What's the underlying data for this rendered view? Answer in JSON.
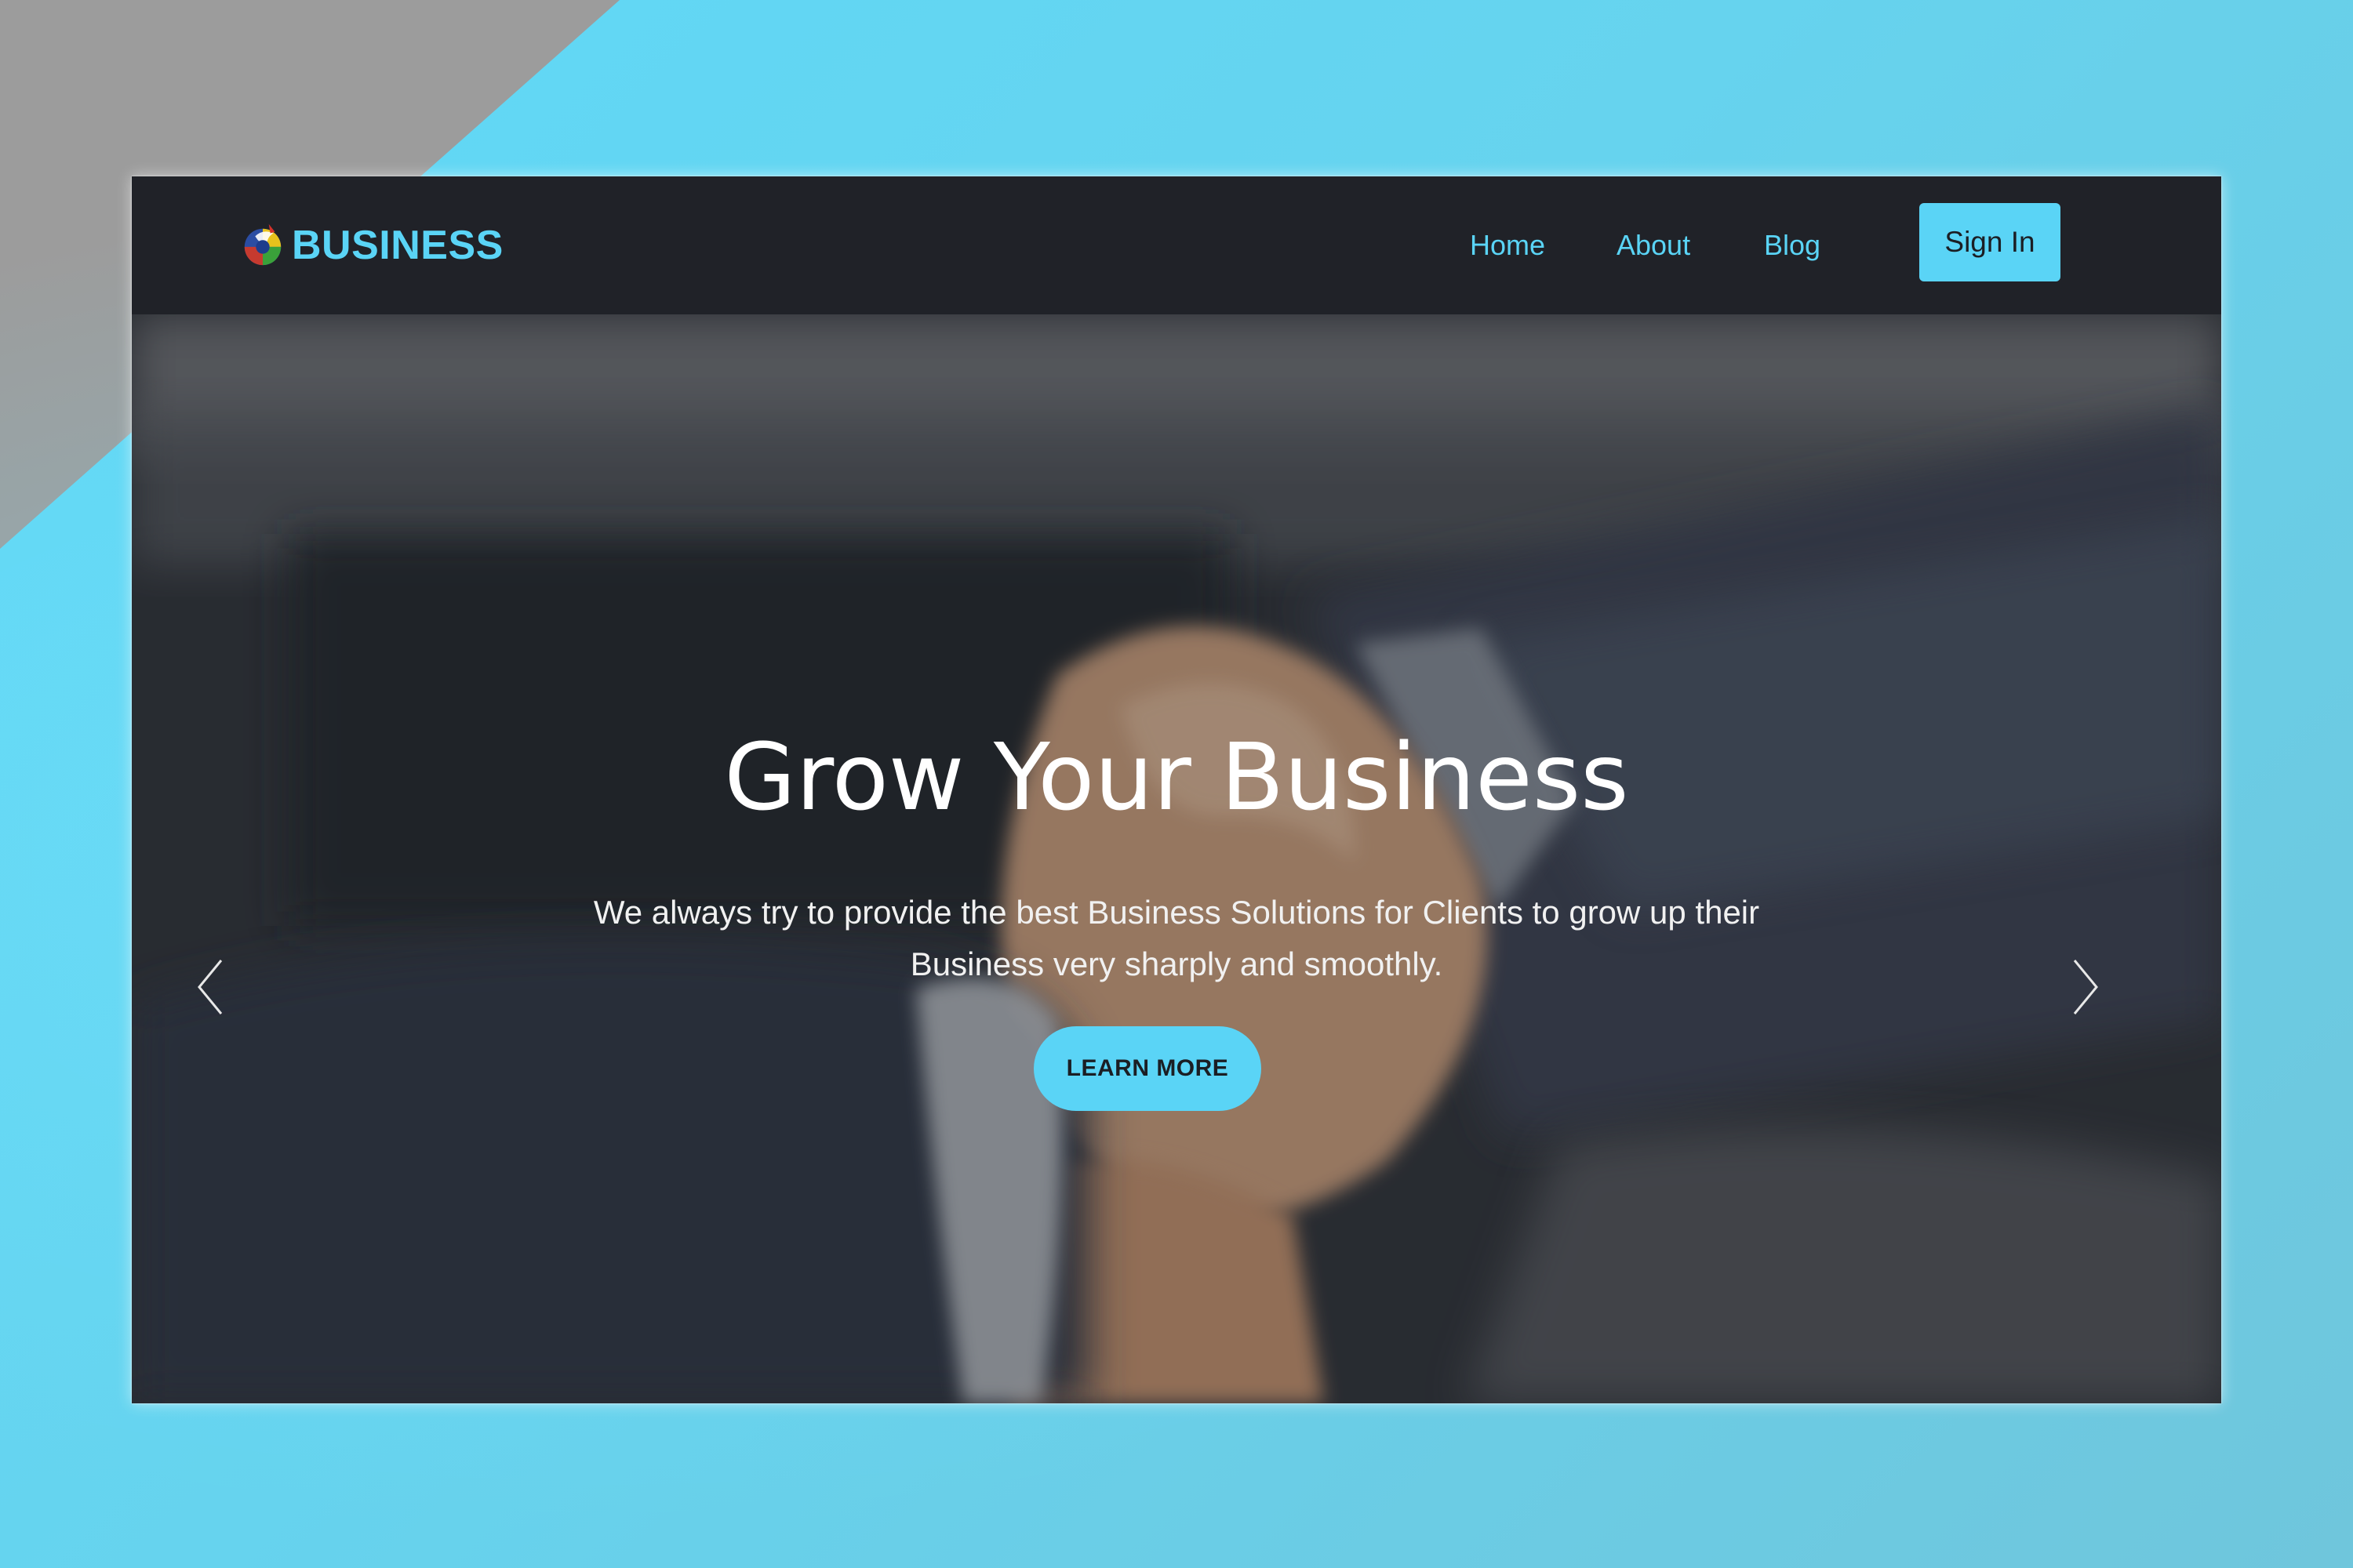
{
  "navbar": {
    "brand": {
      "name": "BUSINESS",
      "logo_icon": "globe-logo-icon"
    },
    "links": [
      {
        "label": "Home"
      },
      {
        "label": "About"
      },
      {
        "label": "Blog"
      }
    ],
    "signin_label": "Sign In"
  },
  "hero": {
    "title": "Grow Your Business",
    "subtitle": "We always try to provide the best Business Solutions for Clients to grow up their Business very sharply and smoothly.",
    "cta_label": "LEARN MORE",
    "prev_icon": "chevron-left-icon",
    "next_icon": "chevron-right-icon",
    "background_image": "handshake-photo"
  },
  "colors": {
    "accent": "#5ad4f6",
    "navbar_bg": "#202228",
    "page_bg": "#66d3ee",
    "corner_gray": "#9c9c9c",
    "text_dark": "#1b1e24",
    "text_light": "#ffffff"
  }
}
